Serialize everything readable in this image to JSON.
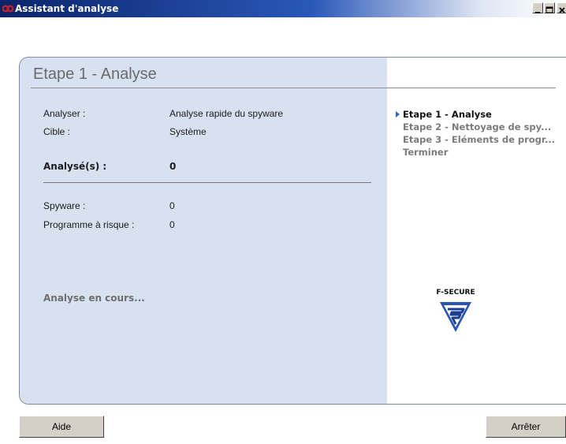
{
  "window": {
    "title": "Assistant d'analyse",
    "icon": "f-secure-infinity-icon"
  },
  "main": {
    "step_title": "Etape 1 - Analyse",
    "fields": [
      {
        "label": "Analyser :",
        "value": "Analyse rapide du spyware"
      },
      {
        "label": "Cible :",
        "value": "Système"
      }
    ],
    "summary": {
      "label": "Analysé(s) :",
      "value": "0"
    },
    "counts": [
      {
        "label": "Spyware :",
        "value": "0"
      },
      {
        "label": "Programme à risque :",
        "value": "0"
      }
    ],
    "status": "Analyse en cours..."
  },
  "steps": [
    {
      "label": "Etape 1 - Analyse",
      "active": true
    },
    {
      "label": "Etape 2 - Nettoyage de spy...",
      "active": false
    },
    {
      "label": "Etape 3 - Eléments de progr...",
      "active": false
    },
    {
      "label": "Terminer",
      "active": false
    }
  ],
  "brand": {
    "logo_text": "F-SECURE",
    "colors": {
      "accent": "#2b67c8",
      "panel": "#d7e1f0",
      "title_bar": "#0a246a"
    }
  },
  "buttons": {
    "help": "Aide",
    "stop": "Arrêter"
  }
}
